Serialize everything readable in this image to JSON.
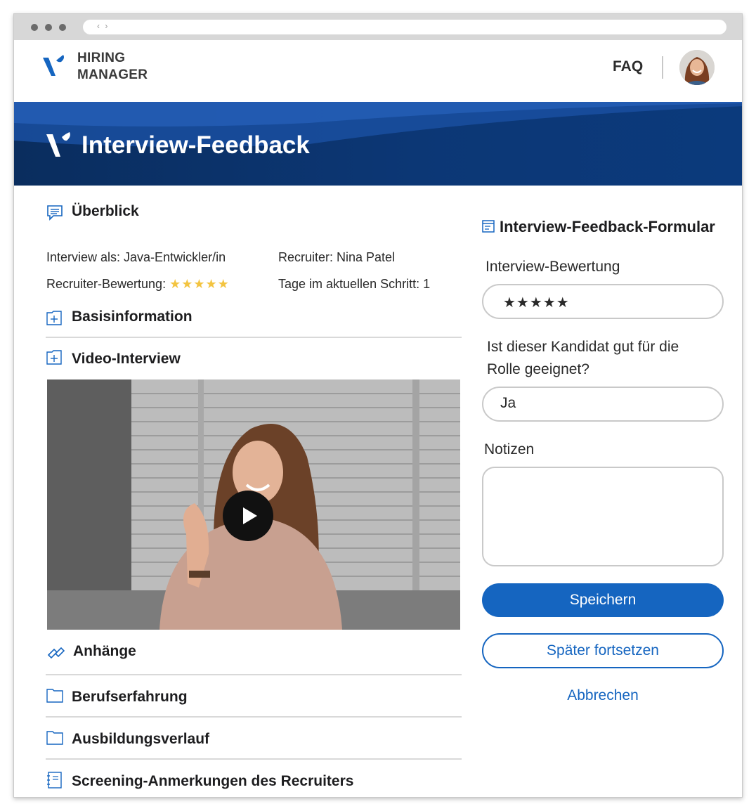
{
  "header": {
    "brand_line1": "HIRING",
    "brand_line2": "MANAGER",
    "faq_label": "FAQ"
  },
  "banner": {
    "title": "Interview-Feedback"
  },
  "overview": {
    "title": "Überblick",
    "interview_as": "Interview als: Java-Entwickler/in",
    "recruiter": "Recruiter: Nina Patel",
    "recruiter_rating_label": "Recruiter-Bewertung:",
    "recruiter_rating_stars": "★★★★★",
    "recruiter_rating_value": 5,
    "days_in_step": "Tage im aktuellen Schritt: 1"
  },
  "sections": {
    "basic_info": "Basisinformation",
    "video_interview": "Video-Interview",
    "attachments": "Anhänge",
    "work_experience": "Berufserfahrung",
    "education": "Ausbildungsverlauf",
    "screening_notes": "Screening-Anmerkungen des Recruiters"
  },
  "form": {
    "title": "Interview-Feedback-Formular",
    "rating_label": "Interview-Bewertung",
    "rating_stars": "★★★★★",
    "rating_value": 5,
    "fit_label_line1": "Ist dieser Kandidat gut für die",
    "fit_label_line2": "Rolle geeignet?",
    "fit_value": "Ja",
    "notes_label": "Notizen",
    "notes_value": "",
    "save_label": "Speichern",
    "continue_later_label": "Später fortsetzen",
    "cancel_label": "Abbrechen"
  },
  "colors": {
    "accent": "#1565c0",
    "banner": "#0a2d5e",
    "stars": "#f3c441"
  }
}
